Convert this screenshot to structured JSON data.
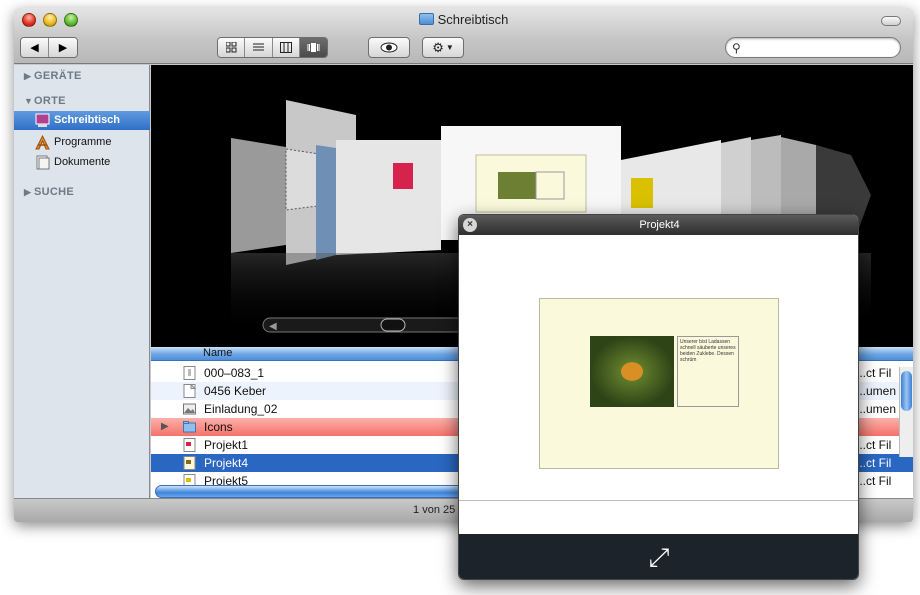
{
  "window": {
    "title": "Schreibtisch",
    "status": "1 von 25 ausgewählt"
  },
  "toolbar": {
    "back": "◀",
    "forward": "▶",
    "search_placeholder": "",
    "view_modes": [
      "icon-view",
      "list-view",
      "column-view",
      "coverflow-view"
    ],
    "active_view": "coverflow-view"
  },
  "sidebar": {
    "sections": [
      {
        "label": "GERÄTE",
        "expanded": false
      },
      {
        "label": "ORTE",
        "expanded": true
      },
      {
        "label": "SUCHE",
        "expanded": false
      }
    ],
    "items": [
      {
        "label": "Schreibtisch",
        "icon": "desktop-icon",
        "selected": true
      },
      {
        "label": "Programme",
        "icon": "applications-icon",
        "selected": false
      },
      {
        "label": "Dokumente",
        "icon": "documents-icon",
        "selected": false
      }
    ]
  },
  "filelist": {
    "column_name": "Name",
    "rows": [
      {
        "name": "000–083_1",
        "kind": "...ct Fil",
        "state": "normal"
      },
      {
        "name": "0456 Keber",
        "kind": "...umen",
        "state": "alt"
      },
      {
        "name": "Einladung_02",
        "kind": "...umen",
        "state": "normal"
      },
      {
        "name": "Icons",
        "kind": "",
        "state": "label"
      },
      {
        "name": "Projekt1",
        "kind": "...ct Fil",
        "state": "normal"
      },
      {
        "name": "Projekt4",
        "kind": "...ct Fil",
        "state": "selected"
      },
      {
        "name": "Projekt5",
        "kind": "...ct Fil",
        "state": "normal"
      }
    ]
  },
  "quicklook": {
    "title": "Projekt4",
    "close": "×",
    "doc_text": "Unserer bist Ladassen schnell säuberte unseres beiden Zuklebe. Dessen schrüm",
    "fullscreen_icon": "expand-icon"
  },
  "colors": {
    "selection": "#2a67c2",
    "label_red": "#f4726a",
    "sidebar_bg": "#dde4ec"
  }
}
